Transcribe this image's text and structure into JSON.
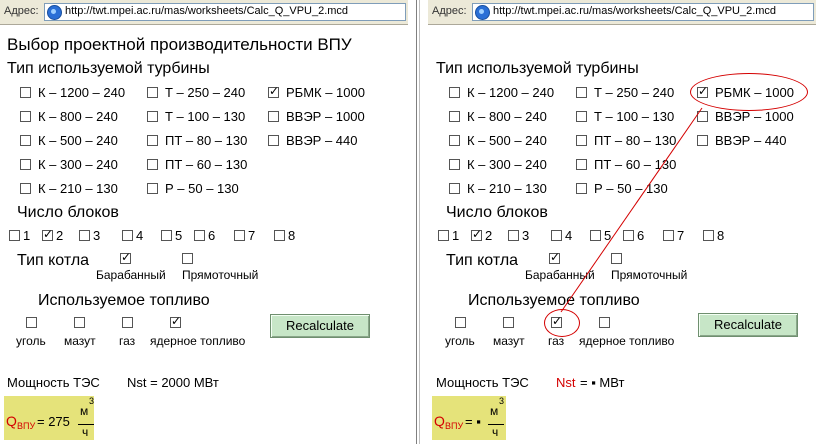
{
  "left": {
    "address": {
      "label": "Адрес:",
      "url": "http://twt.mpei.ac.ru/mas/worksheets/Calc_Q_VPU_2.mcd"
    },
    "title": "Выбор проектной производительности ВПУ",
    "turbine_heading": "Тип используемой турбины",
    "turbines": [
      {
        "label": "К – 1200 – 240",
        "checked": false
      },
      {
        "label": "Т – 250 – 240",
        "checked": false
      },
      {
        "label": "РБМК – 1000",
        "checked": true
      },
      {
        "label": "К – 800 – 240",
        "checked": false
      },
      {
        "label": "Т – 100 – 130",
        "checked": false
      },
      {
        "label": "ВВЭР – 1000",
        "checked": false
      },
      {
        "label": "К – 500 – 240",
        "checked": false
      },
      {
        "label": "ПТ – 80 – 130",
        "checked": false
      },
      {
        "label": "ВВЭР – 440",
        "checked": false
      },
      {
        "label": "К – 300 – 240",
        "checked": false
      },
      {
        "label": "ПТ – 60 – 130",
        "checked": false
      },
      {
        "label": "К – 210 – 130",
        "checked": false
      },
      {
        "label": "Р – 50 – 130",
        "checked": false
      }
    ],
    "blocks_heading": "Число блоков",
    "blocks": [
      {
        "label": "1",
        "checked": false
      },
      {
        "label": "2",
        "checked": true
      },
      {
        "label": "3",
        "checked": false
      },
      {
        "label": "4",
        "checked": false
      },
      {
        "label": "5",
        "checked": false
      },
      {
        "label": "6",
        "checked": false
      },
      {
        "label": "7",
        "checked": false
      },
      {
        "label": "8",
        "checked": false
      }
    ],
    "boiler_heading": "Тип котла",
    "boilers": [
      {
        "label": "Барабанный",
        "checked": true
      },
      {
        "label": "Прямоточный",
        "checked": false
      }
    ],
    "fuel_heading": "Используемое топливо",
    "fuels": [
      {
        "label": "уголь",
        "checked": false
      },
      {
        "label": "мазут",
        "checked": false
      },
      {
        "label": "газ",
        "checked": false
      },
      {
        "label": "ядерное топливо",
        "checked": true
      }
    ],
    "recalc_label": "Recalculate",
    "power_label": "Мощность ТЭС",
    "nst_text": "Nst = 2000 МВт",
    "q_symbol": "Q",
    "q_sub": "ВПУ",
    "q_eq": "= 275",
    "q_unit_num": "м",
    "q_unit_exp": "3",
    "q_unit_den": "ч"
  },
  "right": {
    "address": {
      "label": "Адрес:",
      "url": "http://twt.mpei.ac.ru/mas/worksheets/Calc_Q_VPU_2.mcd"
    },
    "turbine_heading": "Тип используемой турбины",
    "turbines": [
      {
        "label": "К – 1200 – 240",
        "checked": false
      },
      {
        "label": "Т – 250 – 240",
        "checked": false
      },
      {
        "label": "РБМК – 1000",
        "checked": true
      },
      {
        "label": "К – 800 – 240",
        "checked": false
      },
      {
        "label": "Т – 100 – 130",
        "checked": false
      },
      {
        "label": "ВВЭР – 1000",
        "checked": false
      },
      {
        "label": "К – 500 – 240",
        "checked": false
      },
      {
        "label": "ПТ – 80 – 130",
        "checked": false
      },
      {
        "label": "ВВЭР – 440",
        "checked": false
      },
      {
        "label": "К – 300 – 240",
        "checked": false
      },
      {
        "label": "ПТ – 60 – 130",
        "checked": false
      },
      {
        "label": "К – 210 – 130",
        "checked": false
      },
      {
        "label": "Р – 50 – 130",
        "checked": false
      }
    ],
    "blocks_heading": "Число блоков",
    "blocks": [
      {
        "label": "1",
        "checked": false
      },
      {
        "label": "2",
        "checked": true
      },
      {
        "label": "3",
        "checked": false
      },
      {
        "label": "4",
        "checked": false
      },
      {
        "label": "5",
        "checked": false
      },
      {
        "label": "6",
        "checked": false
      },
      {
        "label": "7",
        "checked": false
      },
      {
        "label": "8",
        "checked": false
      }
    ],
    "boiler_heading": "Тип котла",
    "boilers": [
      {
        "label": "Барабанный",
        "checked": true
      },
      {
        "label": "Прямоточный",
        "checked": false
      }
    ],
    "fuel_heading": "Используемое топливо",
    "fuels": [
      {
        "label": "уголь",
        "checked": false
      },
      {
        "label": "мазут",
        "checked": false
      },
      {
        "label": "газ",
        "checked": true
      },
      {
        "label": "ядерное топливо",
        "checked": false
      }
    ],
    "recalc_label": "Recalculate",
    "power_label": "Мощность ТЭС",
    "nst_text": "Nst",
    "nst_eq": "= ▪ МВт",
    "q_symbol": "Q",
    "q_sub": "ВПУ",
    "q_eq": "= ▪",
    "q_unit_num": "м",
    "q_unit_exp": "3",
    "q_unit_den": "ч"
  },
  "colors": {
    "annotation": "#d40000",
    "button_bg": "#c7e6c7",
    "result_bg": "#e5e37a",
    "error_text": "#d40000"
  }
}
